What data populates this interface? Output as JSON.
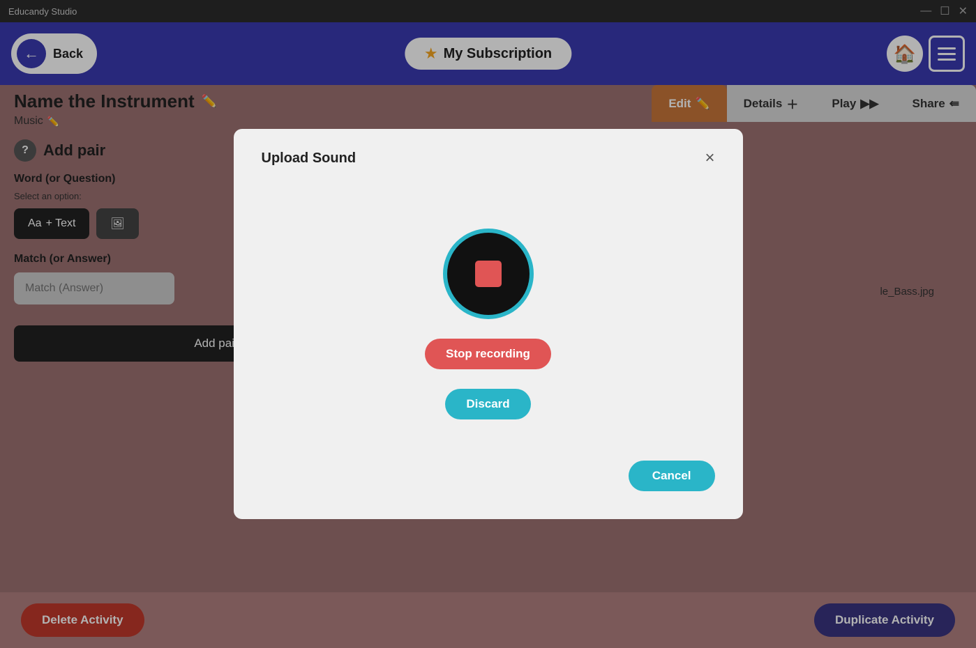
{
  "app": {
    "title": "Educandy Studio"
  },
  "titlebar": {
    "minimize": "—",
    "maximize": "☐",
    "close": "✕"
  },
  "header": {
    "back_label": "Back",
    "subscription_label": "My Subscription",
    "home_icon": "🏠"
  },
  "tabs": {
    "edit": "Edit",
    "details": "Details",
    "play": "Play",
    "share": "Share"
  },
  "activity": {
    "name": "Name the Instrument",
    "subject": "Music"
  },
  "left_panel": {
    "add_pair_title": "Add pair",
    "word_label": "Word (or Question)",
    "select_option": "Select an option:",
    "text_btn": "+ Text",
    "text_btn_prefix": "Aa",
    "match_label": "Match (or Answer)",
    "match_placeholder": "Match (Answer)",
    "add_pair_btn": "Add pair"
  },
  "file_ref": {
    "text": "le_Bass.jpg"
  },
  "bottom": {
    "delete_label": "Delete Activity",
    "duplicate_label": "Duplicate Activity"
  },
  "modal": {
    "title": "Upload Sound",
    "close_icon": "×",
    "stop_recording_label": "Stop recording",
    "discard_label": "Discard",
    "cancel_label": "Cancel"
  }
}
